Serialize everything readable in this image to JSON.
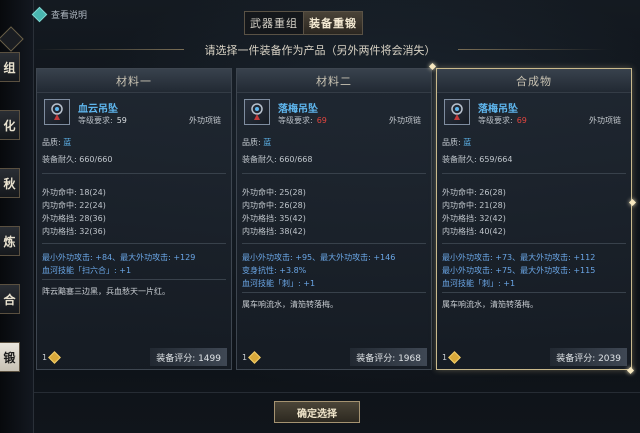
{
  "help": {
    "label": "查看说明",
    "icon": "diamond-help-icon"
  },
  "tabs": [
    {
      "label": "武器重组",
      "active": false
    },
    {
      "label": "装备重锻",
      "active": true
    }
  ],
  "instruction": "请选择一件装备作为产品（另外两件将会消失）",
  "left_rail": [
    "组",
    "化",
    "秋",
    "炼",
    "合",
    "锻"
  ],
  "panels": [
    {
      "title": "材料一",
      "item_name": "血云吊坠",
      "level_label": "等级要求:",
      "level_value": "59",
      "level_red": false,
      "type": "外功项链",
      "quality_label": "品质:",
      "quality_value": "蓝",
      "durability": "装备耐久:  660/660",
      "stats": [
        "外功命中: 18(24)",
        "内功命中: 22(24)",
        "外功格挡: 28(36)",
        "内功格挡: 32(36)"
      ],
      "affixes": [
        "最小外功攻击: +84、最大外功攻击: +129",
        "血河技能「扫六合」: +1"
      ],
      "desc": "阵云黯塞三边黑，兵血愁天一片红。",
      "foot_num": "1",
      "score": "装备评分:  1499"
    },
    {
      "title": "材料二",
      "item_name": "落梅吊坠",
      "level_label": "等级要求:",
      "level_value": "69",
      "level_red": true,
      "type": "外功项链",
      "quality_label": "品质:",
      "quality_value": "蓝",
      "durability": "装备耐久:  660/668",
      "stats": [
        "外功命中: 25(28)",
        "内功命中: 26(28)",
        "外功格挡: 35(42)",
        "内功格挡: 38(42)"
      ],
      "affixes": [
        "最小外功攻击: +95、最大外功攻击: +146",
        "变身抗性: +3.8%",
        "血河技能「刺」: +1"
      ],
      "desc": "属车响流水，清笳转落梅。",
      "foot_num": "1",
      "score": "装备评分:  1968"
    },
    {
      "title": "合成物",
      "item_name": "落梅吊坠",
      "level_label": "等级要求:",
      "level_value": "69",
      "level_red": true,
      "type": "外功项链",
      "quality_label": "品质:",
      "quality_value": "蓝",
      "durability": "装备耐久:  659/664",
      "stats": [
        "外功命中: 26(28)",
        "内功命中: 21(28)",
        "外功格挡: 32(42)",
        "内功格挡: 40(42)"
      ],
      "affixes": [
        "最小外功攻击: +73、最大外功攻击: +112",
        "最小外功攻击: +75、最大外功攻击: +115",
        "血河技能「刺」: +1"
      ],
      "desc": "属车响流水，清笳转落梅。",
      "foot_num": "1",
      "score": "装备评分:  2039"
    }
  ],
  "confirm_label": "确定选择",
  "colors": {
    "accent_blue": "#5fb7ef",
    "red": "#e2463f",
    "gold": "#d9a93a"
  }
}
